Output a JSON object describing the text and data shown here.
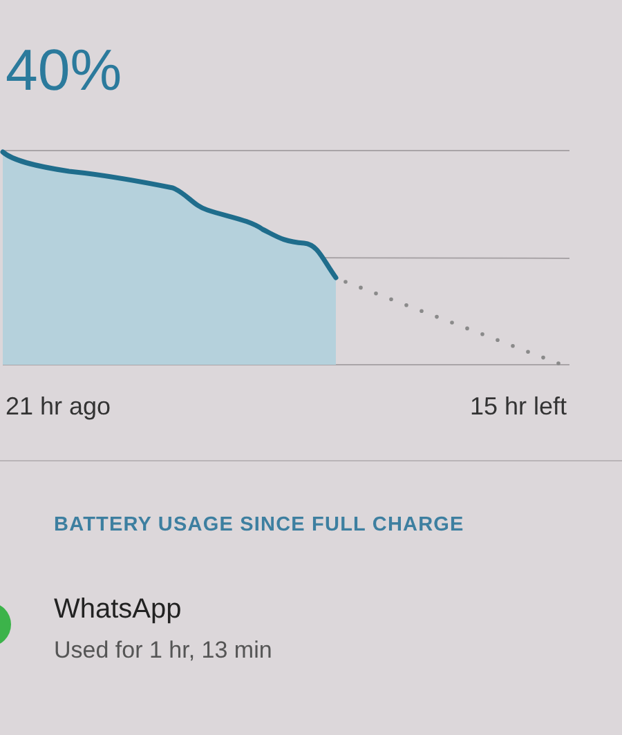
{
  "battery_percent": "40%",
  "graph": {
    "start_label": "21 hr ago",
    "end_label": "15 hr left"
  },
  "section_header": "BATTERY USAGE SINCE FULL CHARGE",
  "apps": [
    {
      "name": "WhatsApp",
      "usage": "Used for 1 hr, 13 min"
    }
  ]
}
